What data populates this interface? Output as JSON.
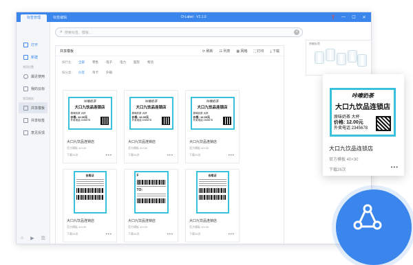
{
  "window": {
    "title": "D-Label · V1.1.0",
    "tabs": [
      "标签管理",
      "标签编辑"
    ]
  },
  "sidebar": {
    "items": [
      {
        "label": "打开",
        "style": "blue"
      },
      {
        "label": "新建",
        "style": "blue"
      }
    ],
    "section1": "常用位置",
    "items2": [
      {
        "label": "最近使用"
      },
      {
        "label": "我的云标"
      }
    ],
    "section2": "常用服务",
    "items3": [
      {
        "label": "共享模板",
        "active": true
      },
      {
        "label": "共享标签"
      },
      {
        "label": "意见反馈"
      }
    ]
  },
  "search": {
    "placeholder": "搜索标签、模板..."
  },
  "panel": {
    "title": "共享模板",
    "tools": [
      "⟳ 刷新",
      "☷ 列表",
      "▦ 网格",
      "⛶ 打印",
      "⤓ 下载"
    ],
    "filter1": {
      "label": "按行业:",
      "options": [
        "全部",
        "零售",
        "电子",
        "电力",
        "医院",
        "物流"
      ],
      "selected": 0
    },
    "filter2": {
      "label": "按分类:",
      "options": [
        "价签",
        "吊卡",
        "外箱"
      ],
      "selected": 0
    }
  },
  "cards": [
    {
      "name": "大口九饮品连锁店",
      "meta": "官方模板 40×30",
      "downloads": "下载26次"
    },
    {
      "name": "大口九饮品连锁店",
      "meta": "官方模板 40×30",
      "downloads": "下载26次"
    },
    {
      "name": "大口九饮品连锁店",
      "meta": "官方模板 40×30",
      "downloads": "下载26次"
    },
    {
      "name": "大口九饮品连锁店",
      "meta": "官方模板 40×30",
      "downloads": "下载26次"
    },
    {
      "name": "大口九饮品连锁店",
      "meta": "官方模板 40×30",
      "downloads": "下载26次"
    },
    {
      "name": "大口九饮品连锁店",
      "meta": "官方模板 40×30",
      "downloads": "下载26次"
    }
  ],
  "label": {
    "brand": "咔嚓奶茶",
    "store": "大口九饮品连锁店",
    "row1": "原味奶茶 大杯",
    "row2": "价格: 12.00元",
    "row3": "外卖电话 2345678"
  },
  "ship_label": {
    "title": "合格证",
    "big": "F",
    "to": "TO:"
  },
  "preview_area": {
    "title": "热敏标签"
  },
  "popup": {
    "name": "大口九饮品连锁店",
    "meta": "官方模板 40×30",
    "downloads": "下载26次"
  },
  "colors": {
    "accent": "#3a86ec",
    "label_border": "#39c0dc"
  },
  "icons": {
    "share": "share-icon"
  }
}
